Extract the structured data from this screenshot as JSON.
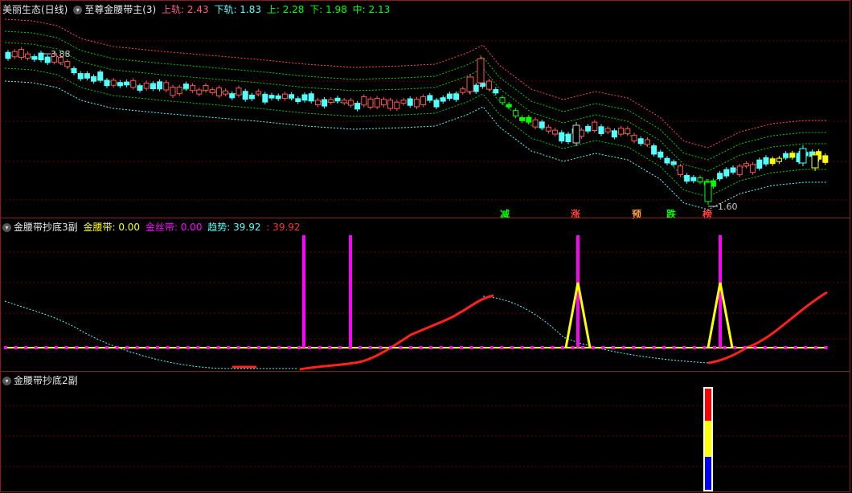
{
  "main": {
    "stock_name": "美丽生态(日线)",
    "indicator_name": "至尊金腰带主(3)",
    "upper_rail_label": "上轨: 2.43",
    "lower_rail_label": "下轨: 1.83",
    "up_label": "上: 2.28",
    "down_label": "下: 1.98",
    "mid_label": "中: 2.13",
    "high_marker": "3.88",
    "low_marker": "1.60",
    "signals": [
      "减",
      "涨",
      "预",
      "跌",
      "榜"
    ]
  },
  "sub1": {
    "indicator_name": "金腰带抄底3副",
    "golden_belt_label": "金腰带: 0.00",
    "silk_belt_label": "金丝带: 0.00",
    "trend_label": "趋势: 39.92",
    "trend_value2": ": 39.92"
  },
  "sub2": {
    "indicator_name": "金腰带抄底2副"
  },
  "colors": {
    "border": "#8b1a1a",
    "grid": "#6b0000",
    "up_candle": "#ff5454",
    "down_candle": "#54ffff",
    "green_candle": "#00ff00",
    "yellow_candle": "#ffff00",
    "magenta": "#ff00ff",
    "yellow": "#ffff00",
    "red_line": "#ff2020",
    "cyan_dash": "#54ffff"
  }
}
